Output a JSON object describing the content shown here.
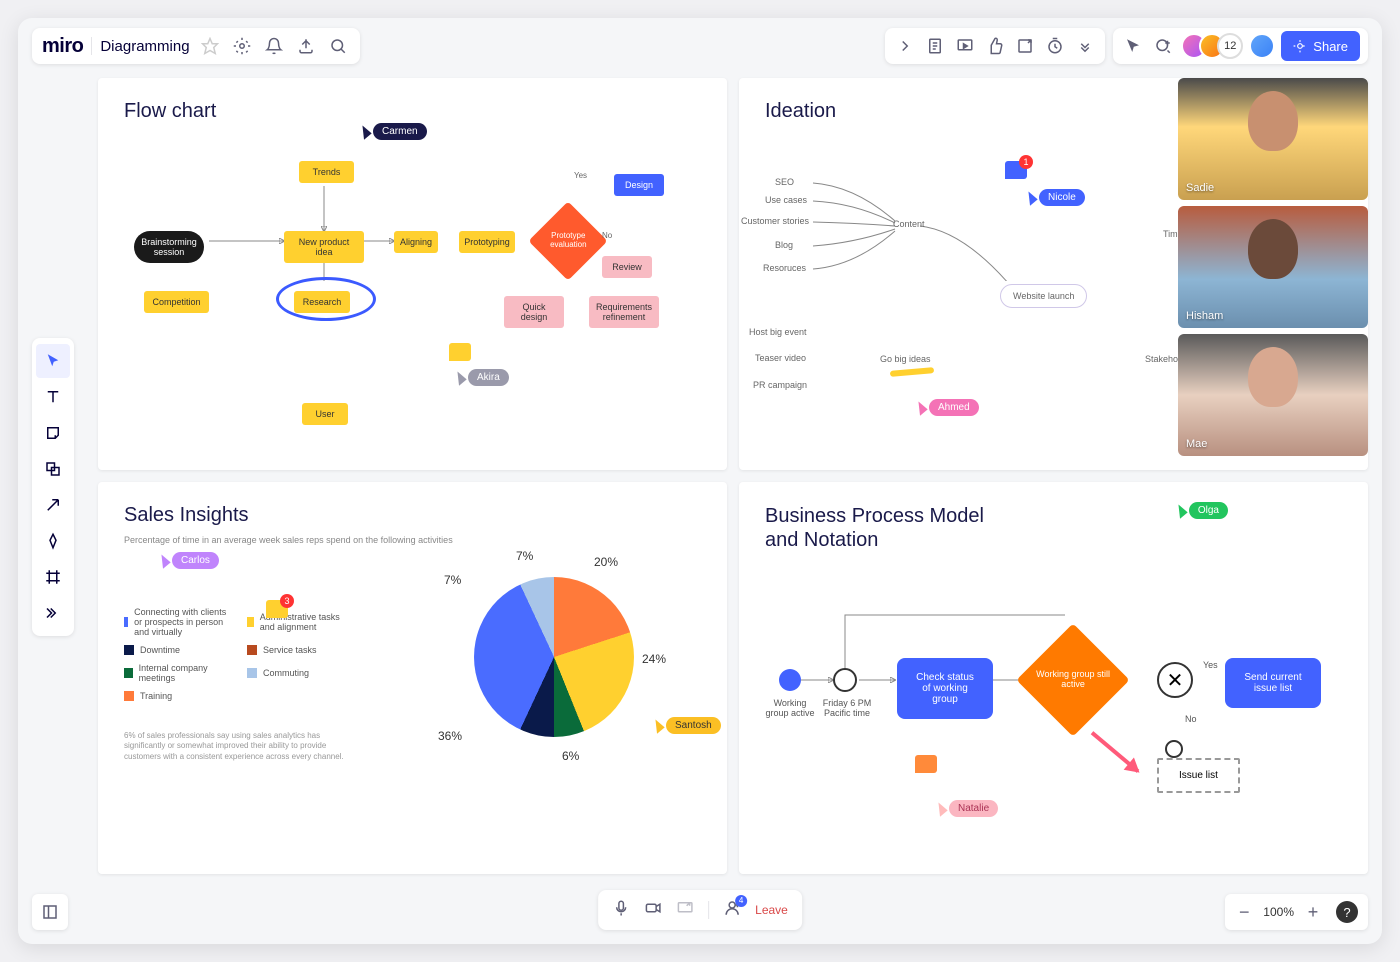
{
  "brand": "miro",
  "board_title": "Diagramming",
  "avatar_count": "12",
  "share_label": "Share",
  "zoom": "100%",
  "leave_label": "Leave",
  "invite_badge": "4",
  "videos": [
    {
      "name": "Sadie"
    },
    {
      "name": "Hisham"
    },
    {
      "name": "Mae"
    }
  ],
  "flowchart": {
    "title": "Flow chart",
    "nodes": {
      "trends": "Trends",
      "brainstorm": "Brainstorming session",
      "new_product": "New product idea",
      "aligning": "Aligning",
      "prototyping": "Prototyping",
      "evaluation": "Prototype evaluation",
      "design": "Design",
      "review": "Review",
      "quick_design": "Quick design",
      "requirements": "Requirements refinement",
      "competition": "Competition",
      "research": "Research",
      "user": "User",
      "yes": "Yes",
      "no": "No"
    }
  },
  "ideation": {
    "title": "Ideation",
    "center": "Website launch",
    "branches": {
      "content": "Content",
      "gobig": "Go big ideas",
      "timing": "Timing",
      "stakeholders": "Stakeholders"
    },
    "leaves": {
      "seo": "SEO",
      "usecases": "Use cases",
      "stories": "Customer stories",
      "blog": "Blog",
      "resources": "Resoruces",
      "hostbig": "Host big event",
      "teaser": "Teaser video",
      "pr": "PR campaign"
    },
    "comment_badge": "1"
  },
  "sales": {
    "title": "Sales Insights",
    "subtitle": "Percentage of time in an average week sales reps spend on the following activities",
    "legend": [
      {
        "label": "Connecting with clients or prospects in person and virtually",
        "color": "#4a6cff"
      },
      {
        "label": "Administrative tasks and alignment",
        "color": "#ffd02f"
      },
      {
        "label": "Downtime",
        "color": "#0a1a4a"
      },
      {
        "label": "Service tasks",
        "color": "#b84a1f"
      },
      {
        "label": "Internal company meetings",
        "color": "#0a6b3a"
      },
      {
        "label": "Commuting",
        "color": "#a8c5e8"
      },
      {
        "label": "Training",
        "color": "#ff7a3a"
      }
    ],
    "footnote": "6% of sales professionals say using sales analytics has significantly or somewhat improved their ability to provide customers with a consistent experience across every channel.",
    "comment_badge": "3"
  },
  "chart_data": {
    "type": "pie",
    "title": "Sales Insights",
    "series": [
      {
        "name": "Connecting with clients or prospects in person and virtually",
        "value": 36,
        "color": "#4a6cff"
      },
      {
        "name": "Administrative tasks and alignment",
        "value": 24,
        "color": "#ffd02f"
      },
      {
        "name": "Downtime",
        "value": 7,
        "color": "#0a1a4a"
      },
      {
        "name": "Service tasks",
        "value": 7,
        "color": "#b84a1f"
      },
      {
        "name": "Internal company meetings",
        "value": 6,
        "color": "#0a6b3a"
      },
      {
        "name": "Commuting",
        "value": 7,
        "color": "#a8c5e8"
      },
      {
        "name": "Training",
        "value": 20,
        "color": "#ff7a3a"
      }
    ],
    "labels": {
      "l36": "36%",
      "l24": "24%",
      "l20": "20%",
      "l7a": "7%",
      "l7b": "7%",
      "l6": "6%"
    }
  },
  "bpmn": {
    "title": "Business Process Model and Notation",
    "start": "Working group active",
    "timer": "Friday 6 PM Pacific time",
    "check": "Check status of working group",
    "active": "Working group still active",
    "send": "Send current issue list",
    "issue": "Issue list",
    "yes": "Yes",
    "no": "No"
  },
  "cursors": {
    "carmen": "Carmen",
    "akira": "Akira",
    "carlos": "Carlos",
    "santosh": "Santosh",
    "nicole": "Nicole",
    "ahmed": "Ahmed",
    "olga": "Olga",
    "natalie": "Natalie"
  }
}
